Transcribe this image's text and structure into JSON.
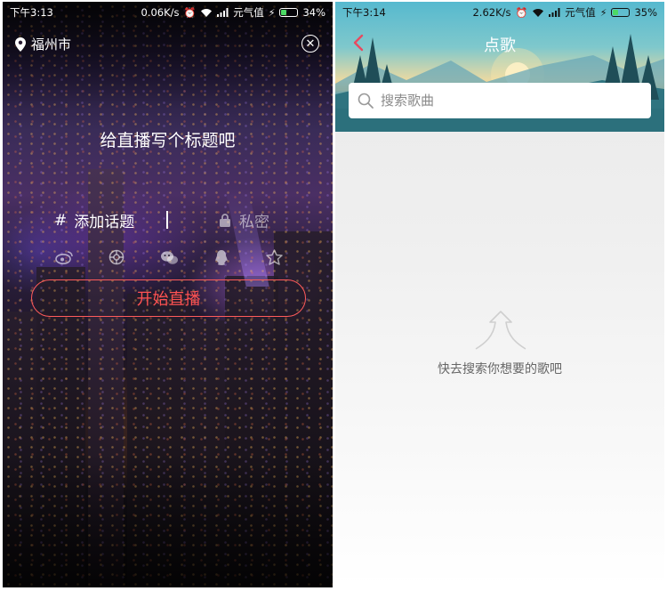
{
  "left": {
    "statusbar": {
      "time": "下午3:13",
      "speed": "0.06K/s",
      "carrier": "元气值",
      "battery": "34%"
    },
    "location": "福州市",
    "title_prompt": "给直播写个标题吧",
    "topic": {
      "hash": "#",
      "label": "添加话题"
    },
    "private_label": "私密",
    "share_icons": [
      "weibo-icon",
      "moments-icon",
      "wechat-icon",
      "qq-icon",
      "qzone-icon"
    ],
    "start_button": "开始直播",
    "accent_color": "#ff5252"
  },
  "right": {
    "statusbar": {
      "time": "下午3:14",
      "speed": "2.62K/s",
      "carrier": "元气值",
      "battery": "35%"
    },
    "title": "点歌",
    "search": {
      "placeholder": "搜索歌曲",
      "value": ""
    },
    "empty_hint": "快去搜索你想要的歌吧",
    "battery_color": "#4cd964"
  }
}
